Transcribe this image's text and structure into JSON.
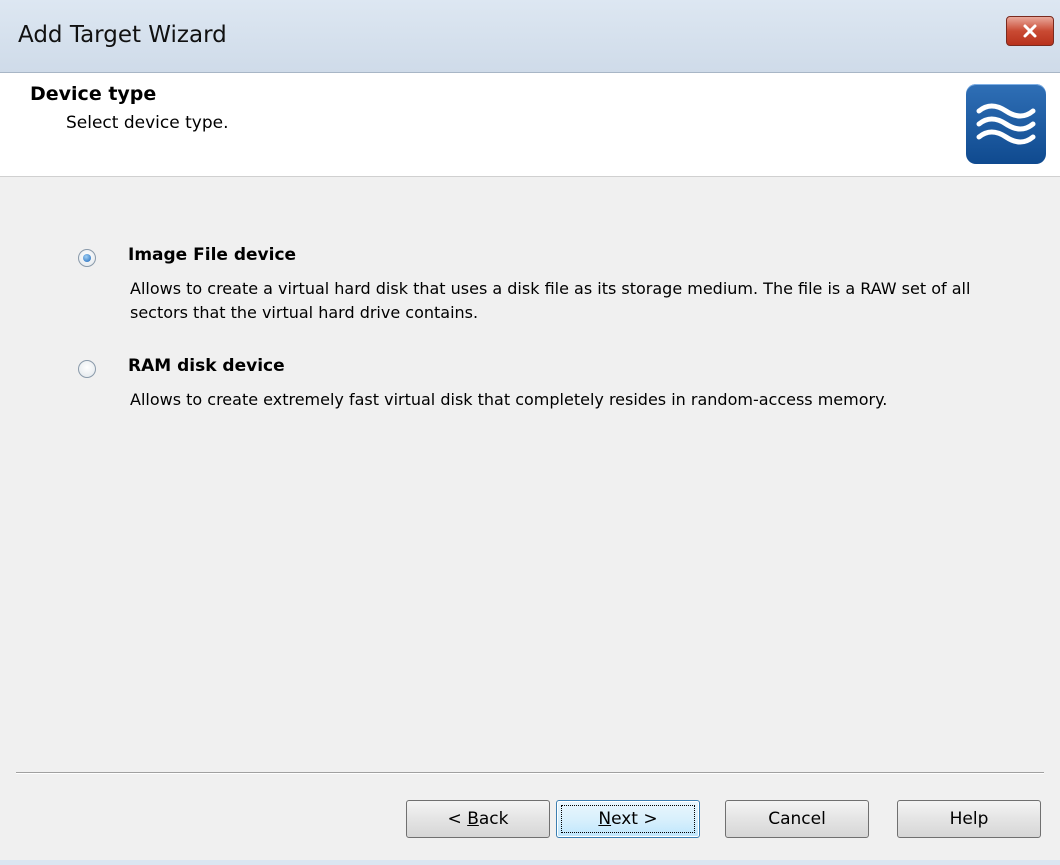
{
  "window": {
    "title": "Add Target Wizard"
  },
  "header": {
    "title": "Device type",
    "subtitle": "Select device type.",
    "logo_icon": "waves-icon"
  },
  "options": [
    {
      "label": "Image File device",
      "description": "Allows to create a virtual hard disk that uses a disk file as its storage medium. The file is a RAW set of all sectors that the virtual hard drive contains.",
      "selected": true
    },
    {
      "label": "RAM disk device",
      "description": "Allows to create extremely fast virtual disk that completely resides in random-access memory.",
      "selected": false
    }
  ],
  "buttons": {
    "back_prefix": "< ",
    "back_mnemonic": "B",
    "back_rest": "ack",
    "next_mnemonic": "N",
    "next_rest": "ext >",
    "cancel": "Cancel",
    "help": "Help"
  },
  "colors": {
    "close_button": "#c94a33",
    "logo": "#1a5aa3",
    "default_button_border": "#3c7fb1"
  }
}
